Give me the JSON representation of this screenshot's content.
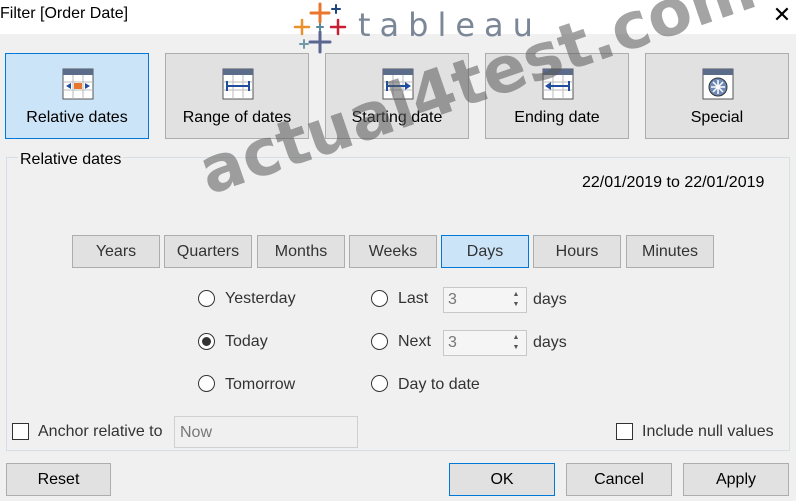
{
  "window": {
    "title": "Filter [Order Date]",
    "close_glyph": "✕"
  },
  "logo": {
    "text": "tableau"
  },
  "filter_types": [
    {
      "label": "Relative dates",
      "icon": "relative-dates-icon",
      "active": true
    },
    {
      "label": "Range of dates",
      "icon": "range-of-dates-icon",
      "active": false
    },
    {
      "label": "Starting date",
      "icon": "starting-date-icon",
      "active": false
    },
    {
      "label": "Ending date",
      "icon": "ending-date-icon",
      "active": false
    },
    {
      "label": "Special",
      "icon": "special-icon",
      "active": false
    }
  ],
  "relative": {
    "group_label": "Relative dates",
    "range_text": "22/01/2019 to 22/01/2019",
    "units": [
      "Years",
      "Quarters",
      "Months",
      "Weeks",
      "Days",
      "Hours",
      "Minutes"
    ],
    "selected_unit": "Days",
    "options": {
      "yesterday": "Yesterday",
      "today": "Today",
      "tomorrow": "Tomorrow",
      "last": "Last",
      "next": "Next",
      "to_date": "Day to date"
    },
    "selected_option": "Today",
    "last_value": "3",
    "next_value": "3",
    "period_unit": "days"
  },
  "anchor": {
    "label": "Anchor relative to",
    "checked": false,
    "value": "Now"
  },
  "include_null": {
    "label": "Include null values",
    "checked": false
  },
  "footer": {
    "reset": "Reset",
    "ok": "OK",
    "cancel": "Cancel",
    "apply": "Apply"
  },
  "watermark": "actual4test.com",
  "colors": {
    "active_fill": "#cce4f7",
    "active_border": "#0078d7",
    "button_fill": "#e1e1e1",
    "dialog_bg": "#f0f0f0"
  }
}
